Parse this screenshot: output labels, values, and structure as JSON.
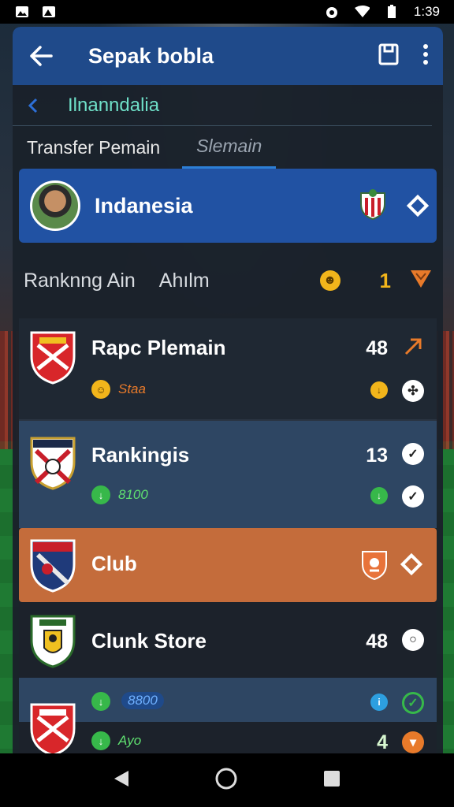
{
  "status": {
    "time": "1:39"
  },
  "appbar": {
    "title": "Sepak bobla"
  },
  "subheader": {
    "text": "Ilnanndalia"
  },
  "tabs": [
    {
      "label": "Transfer Pemain"
    },
    {
      "label": "Slemain"
    }
  ],
  "hero": {
    "name": "Indanesia"
  },
  "ranking": {
    "label1": "Ranknng Ain",
    "label2": "Ahılm",
    "number": "1"
  },
  "cards": [
    {
      "title": "Rapc Plemain",
      "number": "48",
      "sub": "Staa"
    },
    {
      "title": "Rankingis",
      "number": "13",
      "sub": "8100"
    },
    {
      "title": "Club"
    },
    {
      "title": "Clunk Store",
      "number": "48"
    },
    {
      "sub1": "8800",
      "sub2": "Ayo",
      "number": "4"
    }
  ],
  "colors": {
    "appbar": "#1f4a8a",
    "hero": "#2152a3",
    "club_row": "#c46c3b",
    "accent_teal": "#6fe0c8",
    "accent_gold": "#f2b51b"
  }
}
